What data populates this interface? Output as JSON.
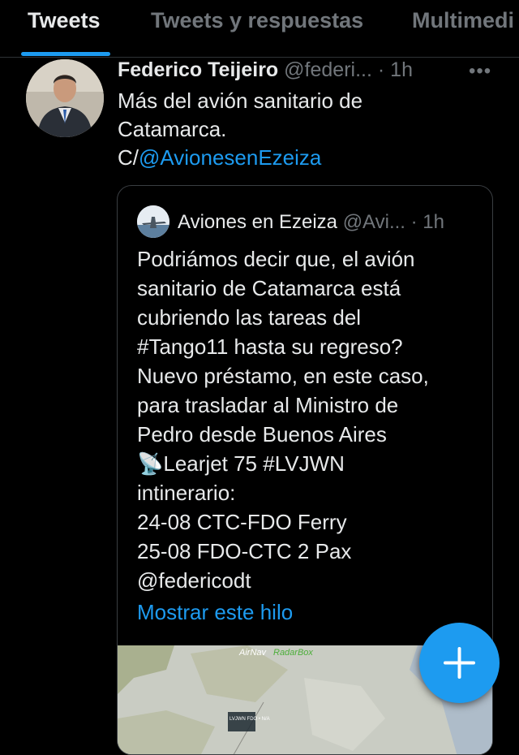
{
  "tabs": [
    {
      "label": "Tweets",
      "active": true
    },
    {
      "label": "Tweets y respuestas",
      "active": false
    },
    {
      "label": "Multimedi",
      "active": false
    }
  ],
  "tweet": {
    "author_name": "Federico Teijeiro",
    "handle": "@federi...",
    "time": "· 1h",
    "more_icon": "more-horizontal-icon",
    "text_line1": "Más del avión sanitario de",
    "text_line2": "Catamarca.",
    "text_prefix": "C/",
    "mention": "@AvionesenEzeiza"
  },
  "quoted_tweet": {
    "author_name": "Aviones en Ezeiza",
    "handle": "@Avi...",
    "time": "· 1h",
    "lines": [
      "Podriámos decir que, el avión",
      "sanitario de Catamarca está",
      "cubriendo las tareas del",
      "#Tango11 hasta su regreso?",
      "Nuevo préstamo, en este caso,",
      "para trasladar al Ministro de",
      "Pedro desde Buenos Aires",
      "📡Learjet 75 #LVJWN",
      "intinerario:",
      "24-08 CTC-FDO Ferry",
      "25-08 FDO-CTC 2 Pax",
      "@federicodt"
    ],
    "show_thread_label": "Mostrar este hilo",
    "image_brand_airnav": "AirNav",
    "image_brand_radarbox": "RadarBox",
    "image_label": "LVJWN FDO • N/A"
  },
  "fab": {
    "icon": "plus-icon"
  },
  "colors": {
    "background": "#000000",
    "accent": "#1d9bf0",
    "text": "#e7e9ea",
    "muted": "#71767b"
  }
}
